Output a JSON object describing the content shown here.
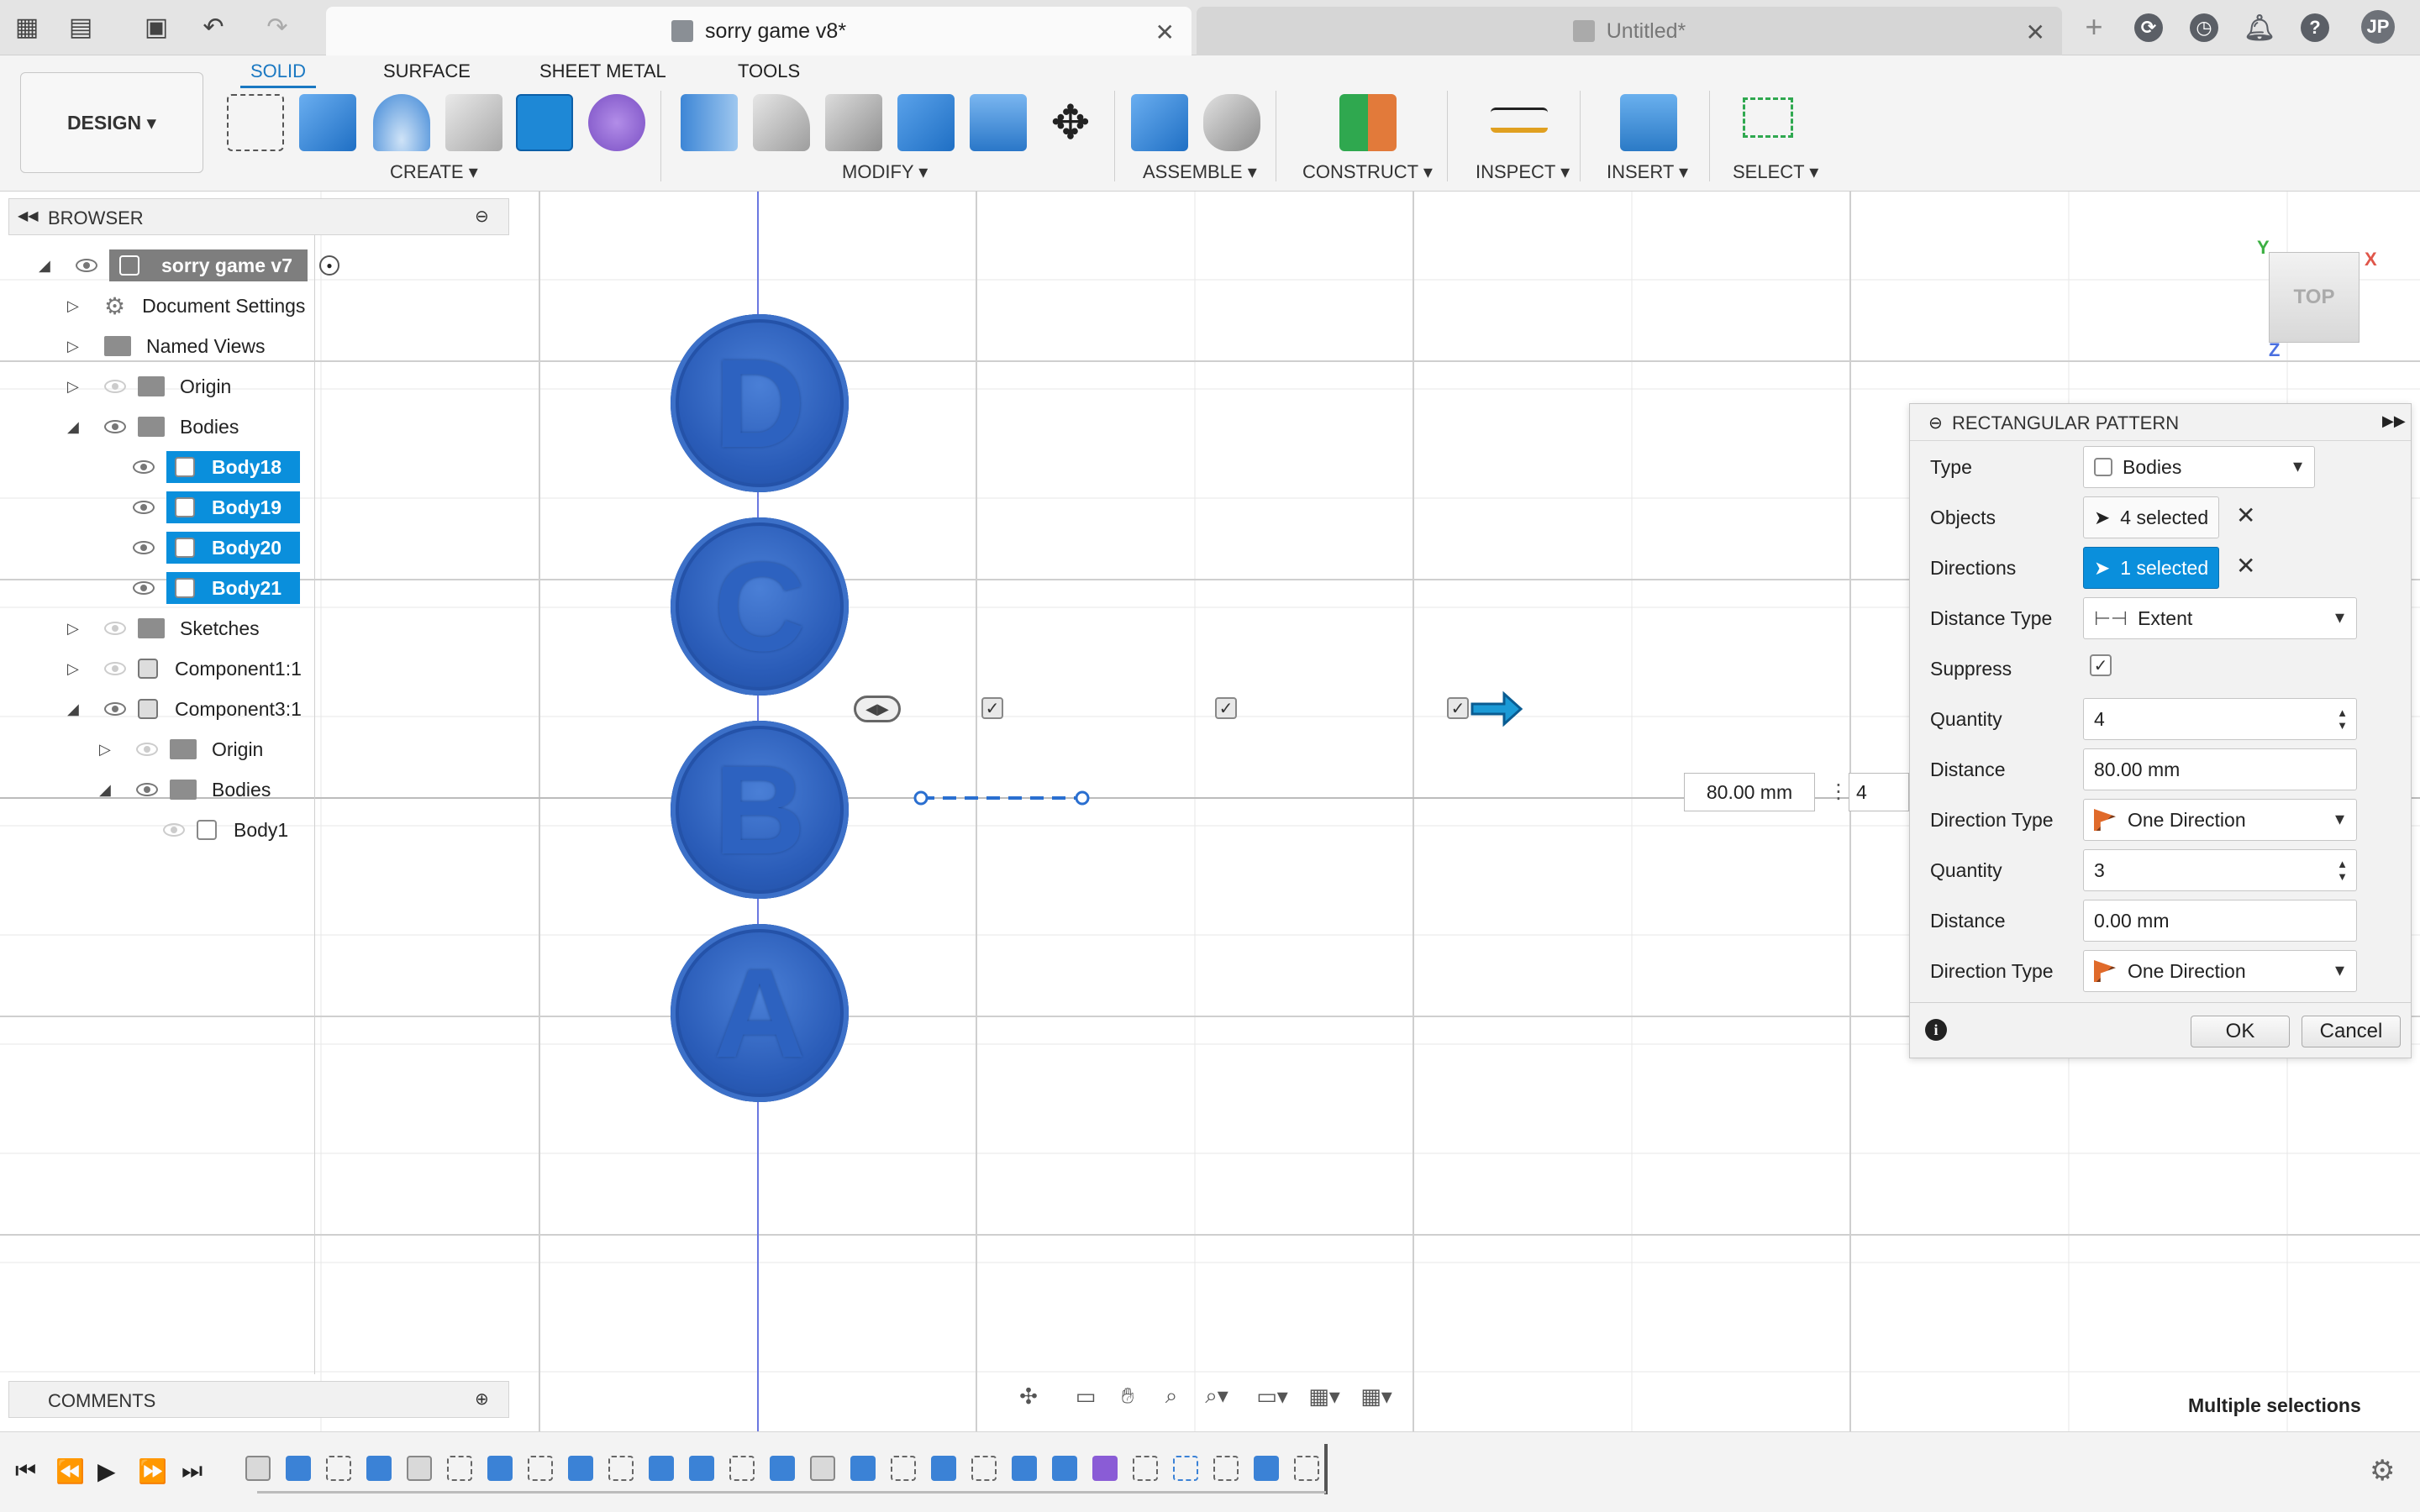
{
  "tabbar": {
    "active_tab": "sorry game v8*",
    "inactive_tab": "Untitled*",
    "close_glyph": "✕",
    "add_glyph": "+",
    "user_initials": "JP"
  },
  "ribbon": {
    "design_button": "DESIGN ▾",
    "tabs": [
      "SOLID",
      "SURFACE",
      "SHEET METAL",
      "TOOLS"
    ],
    "groups": [
      "CREATE ▾",
      "MODIFY ▾",
      "ASSEMBLE ▾",
      "CONSTRUCT ▾",
      "INSPECT ▾",
      "INSERT ▾",
      "SELECT ▾"
    ]
  },
  "browser": {
    "title": "BROWSER",
    "root": "sorry game v7",
    "items": [
      "Document Settings",
      "Named Views",
      "Origin",
      "Bodies",
      "Body18",
      "Body19",
      "Body20",
      "Body21",
      "Sketches",
      "Component1:1",
      "Component3:1",
      "Origin",
      "Bodies",
      "Body1"
    ]
  },
  "comments": {
    "title": "COMMENTS"
  },
  "canvas": {
    "coins": [
      "D",
      "C",
      "B",
      "A"
    ],
    "dimension_value": "80.00 mm",
    "quantity_value": "4",
    "viewcube_label": "TOP",
    "axis_labels": [
      "Y",
      "X",
      "Z"
    ],
    "status": "Multiple selections"
  },
  "dialog": {
    "title": "RECTANGULAR PATTERN",
    "labels": [
      "Type",
      "Objects",
      "Directions",
      "Distance Type",
      "Suppress",
      "Quantity",
      "Distance",
      "Direction Type",
      "Quantity",
      "Distance",
      "Direction Type"
    ],
    "type_value": "Bodies",
    "objects_value": "4 selected",
    "directions_value": "1 selected",
    "distance_type_value": "Extent",
    "quantity1": "4",
    "distance1": "80.00 mm",
    "direction_type1": "One Direction",
    "quantity2": "3",
    "distance2": "0.00 mm",
    "direction_type2": "One Direction",
    "ok": "OK",
    "cancel": "Cancel"
  },
  "colors": {
    "accent": "#1a78c2",
    "selection": "#0a8fdc",
    "body": "#2a5cb8"
  }
}
